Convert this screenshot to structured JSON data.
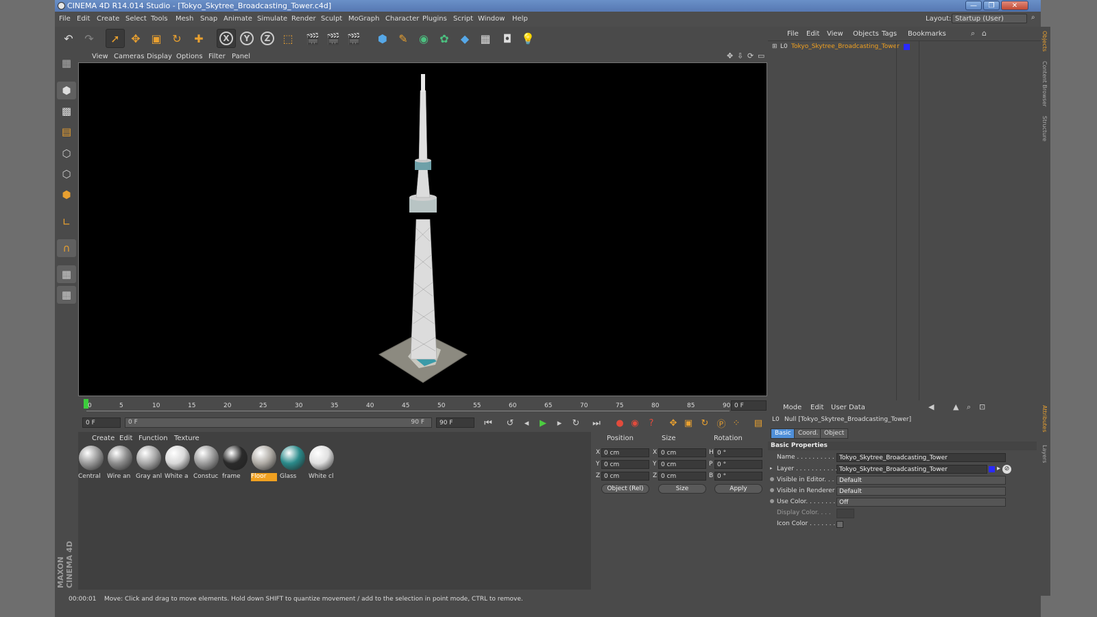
{
  "window": {
    "title": "CINEMA 4D R14.014 Studio - [Tokyo_Skytree_Broadcasting_Tower.c4d]",
    "controls": [
      "—",
      "❐",
      "✕"
    ]
  },
  "menu": [
    "File",
    "Edit",
    "Create",
    "Select",
    "Tools",
    "Mesh",
    "Snap",
    "Animate",
    "Simulate",
    "Render",
    "Sculpt",
    "MoGraph",
    "Character",
    "Plugins",
    "Script",
    "Window",
    "Help"
  ],
  "layout": {
    "label": "Layout:",
    "value": "Startup (User)"
  },
  "viewport": {
    "menu": [
      "View",
      "Cameras",
      "Display",
      "Options",
      "Filter",
      "Panel"
    ]
  },
  "timeline": {
    "ticks": [
      "0",
      "5",
      "10",
      "15",
      "20",
      "25",
      "30",
      "35",
      "40",
      "45",
      "50",
      "55",
      "60",
      "65",
      "70",
      "75",
      "80",
      "85",
      "90"
    ],
    "frame_field": "0 F",
    "start_field": "0 F",
    "range_start": "0 F",
    "range_end": "90 F",
    "end_field": "90 F"
  },
  "material_manager": {
    "menu": [
      "Create",
      "Edit",
      "Function",
      "Texture"
    ],
    "materials": [
      {
        "name": "Central",
        "color": "#9a9a9a",
        "selected": false
      },
      {
        "name": "Wire an",
        "color": "#8c8c8c",
        "selected": false
      },
      {
        "name": "Gray anl",
        "color": "#a8a8a8",
        "selected": false
      },
      {
        "name": "White a",
        "color": "#d8d8d8",
        "selected": false
      },
      {
        "name": "Constuc",
        "color": "#9c9c9c",
        "selected": false
      },
      {
        "name": "frame",
        "color": "#2a2a2a",
        "selected": false
      },
      {
        "name": "Floor",
        "color": "#b0aca6",
        "selected": true
      },
      {
        "name": "Glass",
        "color": "#2a8a8a",
        "selected": false
      },
      {
        "name": "White cl",
        "color": "#e0e0e0",
        "selected": false
      }
    ]
  },
  "coordinates": {
    "headers": [
      "Position",
      "Size",
      "Rotation"
    ],
    "rows": [
      {
        "axis": "X",
        "pos": "0 cm",
        "saxis": "X",
        "size": "0 cm",
        "raxis": "H",
        "rot": "0 °"
      },
      {
        "axis": "Y",
        "pos": "0 cm",
        "saxis": "Y",
        "size": "0 cm",
        "raxis": "P",
        "rot": "0 °"
      },
      {
        "axis": "Z",
        "pos": "0 cm",
        "saxis": "Z",
        "size": "0 cm",
        "raxis": "B",
        "rot": "0 °"
      }
    ],
    "mode_dropdown": "Object (Rel)",
    "size_dropdown": "Size",
    "apply_label": "Apply"
  },
  "object_manager": {
    "menu": [
      "File",
      "Edit",
      "View",
      "Objects",
      "Tags",
      "Bookmarks"
    ],
    "objects": [
      {
        "name": "Tokyo_Skytree_Broadcasting_Tower",
        "layer_color": "#2a2aff"
      }
    ]
  },
  "attributes": {
    "menu": [
      "Mode",
      "Edit",
      "User Data"
    ],
    "header": "Null [Tokyo_Skytree_Broadcasting_Tower]",
    "tabs": [
      "Basic",
      "Coord.",
      "Object"
    ],
    "section": "Basic Properties",
    "props": [
      {
        "key": "Name . . . . . . . . . . . .",
        "value": "Tokyo_Skytree_Broadcasting_Tower",
        "type": "text"
      },
      {
        "key": "Layer . . . . . . . . . . . .",
        "value": "Tokyo_Skytree_Broadcasting_Tower",
        "type": "layer"
      },
      {
        "key": "Visible in Editor. . .",
        "value": "Default",
        "type": "dropdown"
      },
      {
        "key": "Visible in Renderer",
        "value": "Default",
        "type": "dropdown"
      },
      {
        "key": "Use Color. . . . . . . .",
        "value": "Off",
        "type": "dropdown"
      },
      {
        "key": "Display Color. . . .",
        "value": "",
        "type": "swatch"
      },
      {
        "key": "Icon Color . . . . . . .",
        "value": "",
        "type": "checkbox"
      }
    ]
  },
  "status": {
    "time": "00:00:01",
    "message": "Move: Click and drag to move elements. Hold down SHIFT to quantize movement / add to the selection in point mode, CTRL to remove."
  },
  "side_tabs": [
    "Objects",
    "Content Browser",
    "Structure",
    "Attributes",
    "Layers"
  ],
  "branding": "MAXON CINEMA 4D"
}
